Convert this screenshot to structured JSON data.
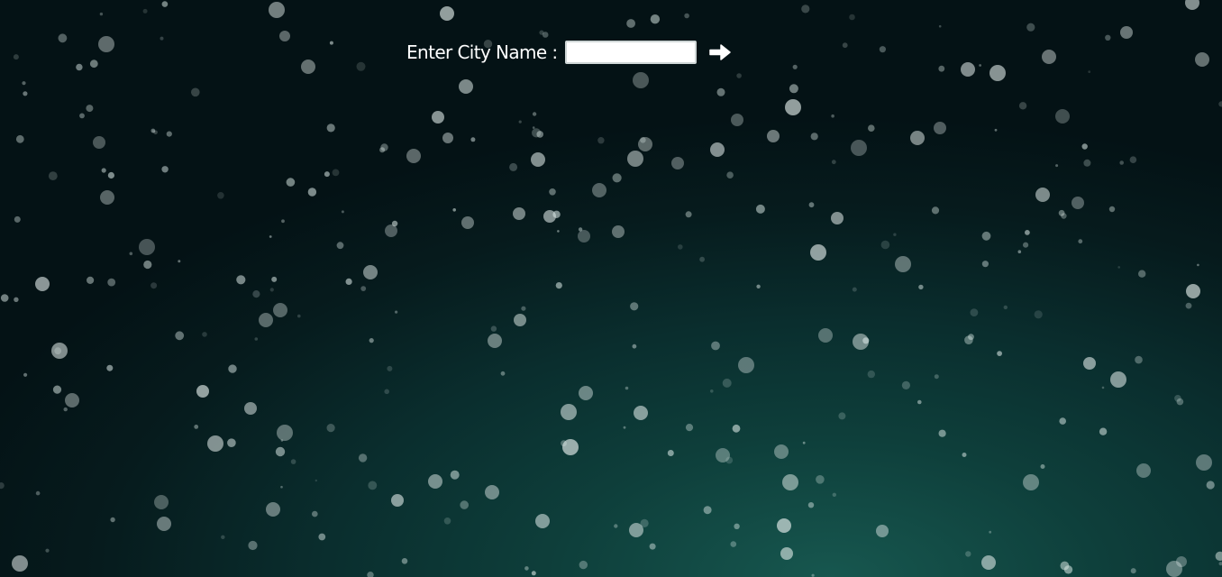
{
  "search": {
    "label": "Enter City Name :",
    "input_value": "",
    "placeholder": "",
    "submit_icon": "arrow-right-icon"
  },
  "theme": {
    "background_accent": "#17574f",
    "background_dark": "#041215",
    "text_color": "#ffffff"
  }
}
